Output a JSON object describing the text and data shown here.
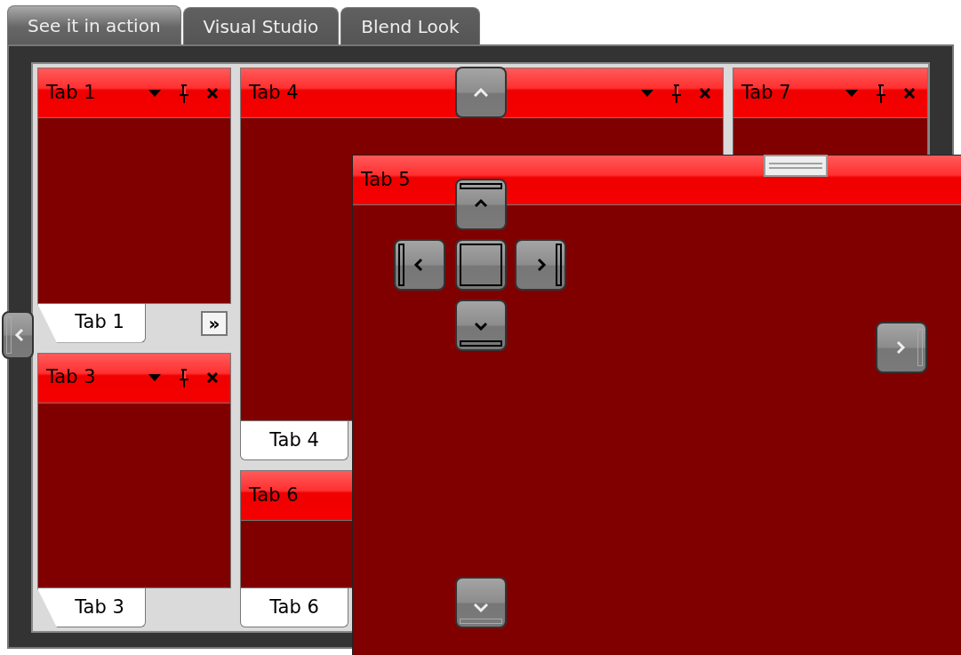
{
  "tabs": [
    {
      "label": "See it in action",
      "selected": true
    },
    {
      "label": "Visual Studio",
      "selected": false
    },
    {
      "label": "Blend Look",
      "selected": false
    }
  ],
  "dock": {
    "columns": [
      {
        "panes": [
          {
            "title": "Tab 1",
            "show_controls": true,
            "tabs": [
              {
                "label": "Tab 1",
                "selected": true,
                "kind": "slanted"
              }
            ],
            "overflow": "»"
          },
          {
            "title": "Tab 3",
            "show_controls": true,
            "tabs": [
              {
                "label": "Tab 3",
                "selected": true,
                "kind": "slanted"
              }
            ]
          }
        ]
      },
      {
        "panes": [
          {
            "title": "Tab 4",
            "show_controls": true,
            "tabs": [
              {
                "label": "Tab 4",
                "selected": true,
                "kind": "plain"
              }
            ]
          },
          {
            "title": "Tab 6",
            "show_controls": false,
            "tabs": [
              {
                "label": "Tab 6",
                "selected": true,
                "kind": "plain"
              }
            ]
          }
        ]
      },
      {
        "panes": [
          {
            "title": "Tab 7",
            "show_controls": true
          }
        ]
      }
    ]
  },
  "floating_window": {
    "title": "Tab 5"
  }
}
